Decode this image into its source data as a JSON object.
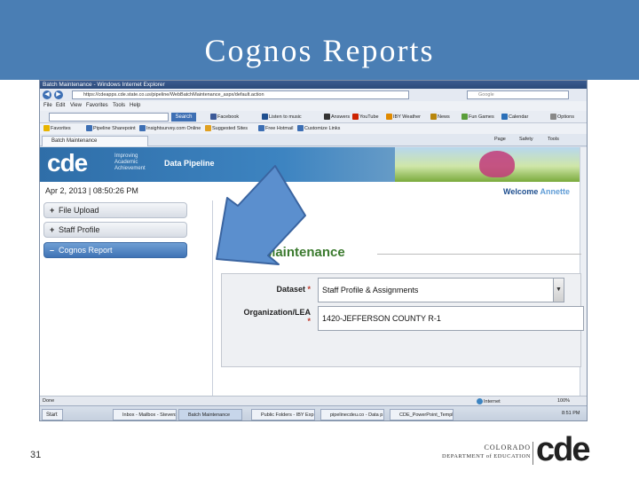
{
  "slide": {
    "title": "Cognos Reports",
    "page_number": "31",
    "title_bar_color": "#4a7eb4"
  },
  "browser": {
    "window_title": "Batch Maintenance - Windows Internet Explorer",
    "address": "https://cdeapps.cde.state.co.us/pipeline/WebBatchMaintenance_aspx/default.action",
    "search_placeholder": "Google",
    "menu": [
      "File",
      "Edit",
      "View",
      "Favorites",
      "Tools",
      "Help"
    ],
    "toolbar": {
      "search_button": "Search",
      "items": [
        "Facebook",
        "Listen to music",
        "Answers",
        "YouTube",
        "IBY Weather",
        "News",
        "Fun Games",
        "Calendar",
        "Options"
      ]
    },
    "favorites": {
      "label": "Favorites",
      "items": [
        "Pipeline Sharepoint",
        "Insightsurvey.com Online",
        "Suggested Sites",
        "Free Hotmail",
        "Customize Links"
      ]
    },
    "tab_label": "Batch Maintenance",
    "tab_tools": [
      "Page",
      "Safety",
      "Tools"
    ],
    "status": {
      "left": "Done",
      "zone": "Internet",
      "zoom": "100%"
    }
  },
  "page": {
    "logo": "cde",
    "tagline": [
      "Improving",
      "Academic",
      "Achievement"
    ],
    "app_name": "Data Pipeline",
    "datetime": "Apr 2, 2013 | 08:50:26 PM",
    "welcome_label": "Welcome",
    "welcome_name": "Annette",
    "sidebar": [
      {
        "symbol": "+",
        "label": "File Upload",
        "active": false
      },
      {
        "symbol": "+",
        "label": "Staff Profile",
        "active": false
      },
      {
        "symbol": "–",
        "label": "Cognos Report",
        "active": true
      }
    ],
    "form_title": "Batch Maintenance",
    "form": {
      "dataset_label": "Dataset",
      "dataset_value": "Staff Profile & Assignments",
      "org_label": "Organization/LEA",
      "org_value": "1420-JEFFERSON COUNTY R-1",
      "required_mark": "*"
    }
  },
  "taskbar": {
    "start": "Start",
    "buttons": [
      "Inbox - Mailbox - Stevens...",
      "Batch Maintenance",
      "Public Folders - IBY Exp...",
      "pipelinecdeu.co - Data p...",
      "CDE_PowerPoint_Templ..."
    ],
    "clock": "8:51 PM"
  },
  "footer": {
    "state": "COLORADO",
    "department": "DEPARTMENT of EDUCATION",
    "logo": "cde"
  },
  "colors": {
    "accent": "#3f73b5",
    "form_title": "#3b7a2e",
    "arrow": "#5b8fce"
  }
}
